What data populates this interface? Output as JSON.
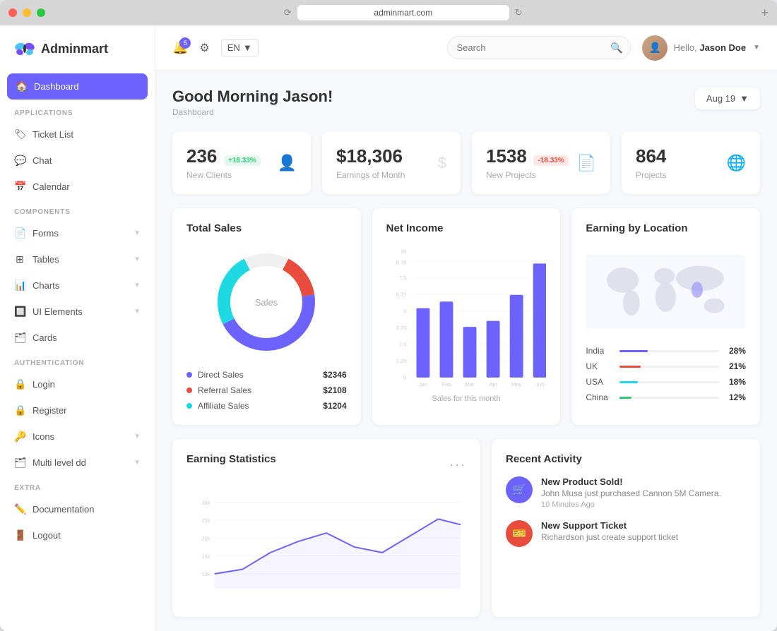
{
  "browser": {
    "url": "adminmart.com",
    "plus_label": "+"
  },
  "logo": {
    "text": "Adminmart"
  },
  "sidebar": {
    "sections": [
      {
        "label": "APPLICATIONS",
        "items": [
          {
            "id": "ticket-list",
            "icon": "🏷",
            "label": "Ticket List",
            "active": false,
            "hasArrow": false
          },
          {
            "id": "chat",
            "icon": "💬",
            "label": "Chat",
            "active": false,
            "hasArrow": false
          },
          {
            "id": "calendar",
            "icon": "📅",
            "label": "Calendar",
            "active": false,
            "hasArrow": false
          }
        ]
      },
      {
        "label": "COMPONENTS",
        "items": [
          {
            "id": "forms",
            "icon": "📄",
            "label": "Forms",
            "active": false,
            "hasArrow": true
          },
          {
            "id": "tables",
            "icon": "⊞",
            "label": "Tables",
            "active": false,
            "hasArrow": true
          },
          {
            "id": "charts",
            "icon": "📊",
            "label": "Charts",
            "active": false,
            "hasArrow": true
          },
          {
            "id": "ui-elements",
            "icon": "🔲",
            "label": "UI Elements",
            "active": false,
            "hasArrow": true
          },
          {
            "id": "cards",
            "icon": "🗂",
            "label": "Cards",
            "active": false,
            "hasArrow": false
          }
        ]
      },
      {
        "label": "AUTHENTICATION",
        "items": [
          {
            "id": "login",
            "icon": "🔒",
            "label": "Login",
            "active": false,
            "hasArrow": false
          },
          {
            "id": "register",
            "icon": "🔒",
            "label": "Register",
            "active": false,
            "hasArrow": false
          },
          {
            "id": "icons",
            "icon": "🔑",
            "label": "Icons",
            "active": false,
            "hasArrow": true
          },
          {
            "id": "multi-level",
            "icon": "🗂",
            "label": "Multi level dd",
            "active": false,
            "hasArrow": true
          }
        ]
      },
      {
        "label": "EXTRA",
        "items": [
          {
            "id": "documentation",
            "icon": "✏️",
            "label": "Documentation",
            "active": false,
            "hasArrow": false
          },
          {
            "id": "logout",
            "icon": "🚪",
            "label": "Logout",
            "active": false,
            "hasArrow": false
          }
        ]
      }
    ],
    "active_item": "dashboard",
    "dashboard_label": "Dashboard"
  },
  "topbar": {
    "bell_count": "5",
    "lang": "EN",
    "search_placeholder": "Search",
    "user_greeting": "Hello,",
    "user_name": "Jason Doe"
  },
  "page": {
    "greeting": "Good Morning Jason!",
    "breadcrumb": "Dashboard",
    "date": "Aug 19"
  },
  "stats": [
    {
      "id": "new-clients",
      "value": "236",
      "badge": "+18.33%",
      "badge_type": "positive",
      "label": "New Clients",
      "icon": "👤"
    },
    {
      "id": "earnings",
      "value": "$18,306",
      "badge": "",
      "badge_type": "",
      "label": "Earnings of Month",
      "icon": "$"
    },
    {
      "id": "new-projects",
      "value": "1538",
      "badge": "-18.33%",
      "badge_type": "negative",
      "label": "New Projects",
      "icon": "📄"
    },
    {
      "id": "projects",
      "value": "864",
      "badge": "",
      "badge_type": "",
      "label": "Projects",
      "icon": "🌐"
    }
  ],
  "total_sales": {
    "title": "Total Sales",
    "center_label": "Sales",
    "legend": [
      {
        "label": "Direct Sales",
        "color": "#6c63ff",
        "amount": "$2346"
      },
      {
        "label": "Referral Sales",
        "color": "#e74c3c",
        "amount": "$2108"
      },
      {
        "label": "Affiliate Sales",
        "color": "#1dd9e2",
        "amount": "$1204"
      }
    ],
    "donut": {
      "segments": [
        {
          "label": "Direct Sales",
          "value": 45,
          "color": "#6c63ff"
        },
        {
          "label": "Referral Sales",
          "value": 30,
          "color": "#e74c3c"
        },
        {
          "label": "Affiliate Sales",
          "value": 25,
          "color": "#1dd9e2"
        }
      ]
    }
  },
  "net_income": {
    "title": "Net Income",
    "footer": "Sales for this month",
    "bars": [
      {
        "month": "Jan",
        "value": 55
      },
      {
        "month": "Feb",
        "value": 60
      },
      {
        "month": "Mar",
        "value": 40
      },
      {
        "month": "Apr",
        "value": 45
      },
      {
        "month": "May",
        "value": 65
      },
      {
        "month": "Jun",
        "value": 90
      }
    ],
    "y_labels": [
      "0",
      "1.25",
      "2.5",
      "3.75",
      "5",
      "6.25",
      "7.5",
      "8.75",
      "10"
    ]
  },
  "earning_by_location": {
    "title": "Earning by Location",
    "locations": [
      {
        "name": "India",
        "pct": 28,
        "color": "#6c63ff"
      },
      {
        "name": "UK",
        "pct": 21,
        "color": "#e74c3c"
      },
      {
        "name": "USA",
        "pct": 18,
        "color": "#1dd9e2"
      },
      {
        "name": "China",
        "pct": 12,
        "color": "#2ecc71"
      }
    ]
  },
  "earning_statistics": {
    "title": "Earning Statistics",
    "y_labels": [
      "10k",
      "15k",
      "20k",
      "25k",
      "30k"
    ],
    "line_color": "#6c63ff"
  },
  "recent_activity": {
    "title": "Recent Activity",
    "items": [
      {
        "id": "product-sold",
        "icon": "🛒",
        "icon_bg": "purple",
        "heading": "New Product Sold!",
        "desc": "John Musa just purchased Cannon 5M Camera.",
        "time": "10 Minutes Ago"
      },
      {
        "id": "support-ticket",
        "icon": "🎫",
        "icon_bg": "red",
        "heading": "New Support Ticket",
        "desc": "Richardson just create support ticket",
        "time": ""
      }
    ]
  }
}
